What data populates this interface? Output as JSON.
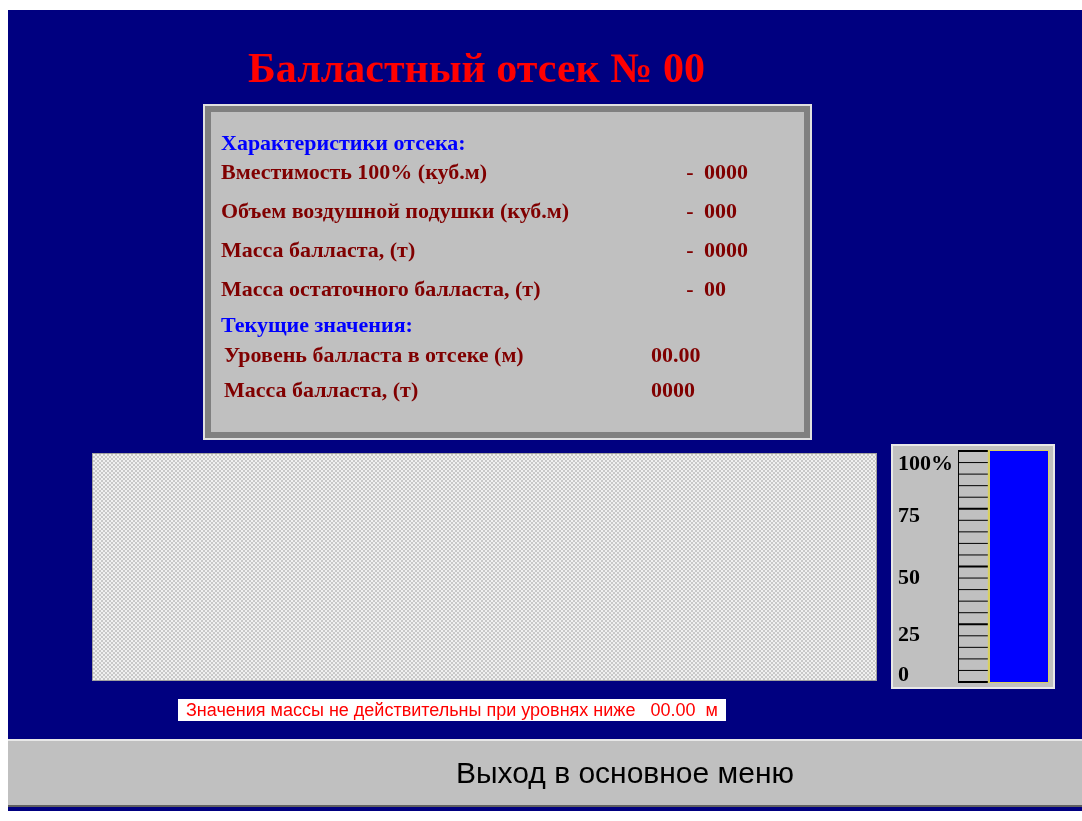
{
  "title": "Балластный отсек № 00",
  "sections": [
    {
      "heading": "Характеристики отсека:",
      "rows": [
        {
          "label": "Вместимость 100% (куб.м)",
          "separator": "-",
          "value": "0000"
        },
        {
          "label": "Объем воздушной подушки (куб.м)",
          "separator": "-",
          "value": "000"
        },
        {
          "label": "Масса балласта, (т)",
          "separator": "-",
          "value": "0000"
        },
        {
          "label": "Масса остаточного балласта, (т)",
          "separator": "-",
          "value": "00"
        }
      ]
    },
    {
      "heading": "Текущие значения:",
      "rows": [
        {
          "label": "Уровень балласта в отсеке (м)",
          "value": "00.00"
        },
        {
          "label": "Масса балласта, (т)",
          "value": "0000"
        }
      ]
    }
  ],
  "gauge": {
    "scale": [
      "100%",
      "75",
      "50",
      "25",
      "0"
    ],
    "level": 1
  },
  "note": {
    "text": "Значения массы не действительны при уровнях ниже",
    "value": "00.00",
    "unit": "м"
  },
  "exit_button": {
    "label": "Выход в основное меню"
  }
}
